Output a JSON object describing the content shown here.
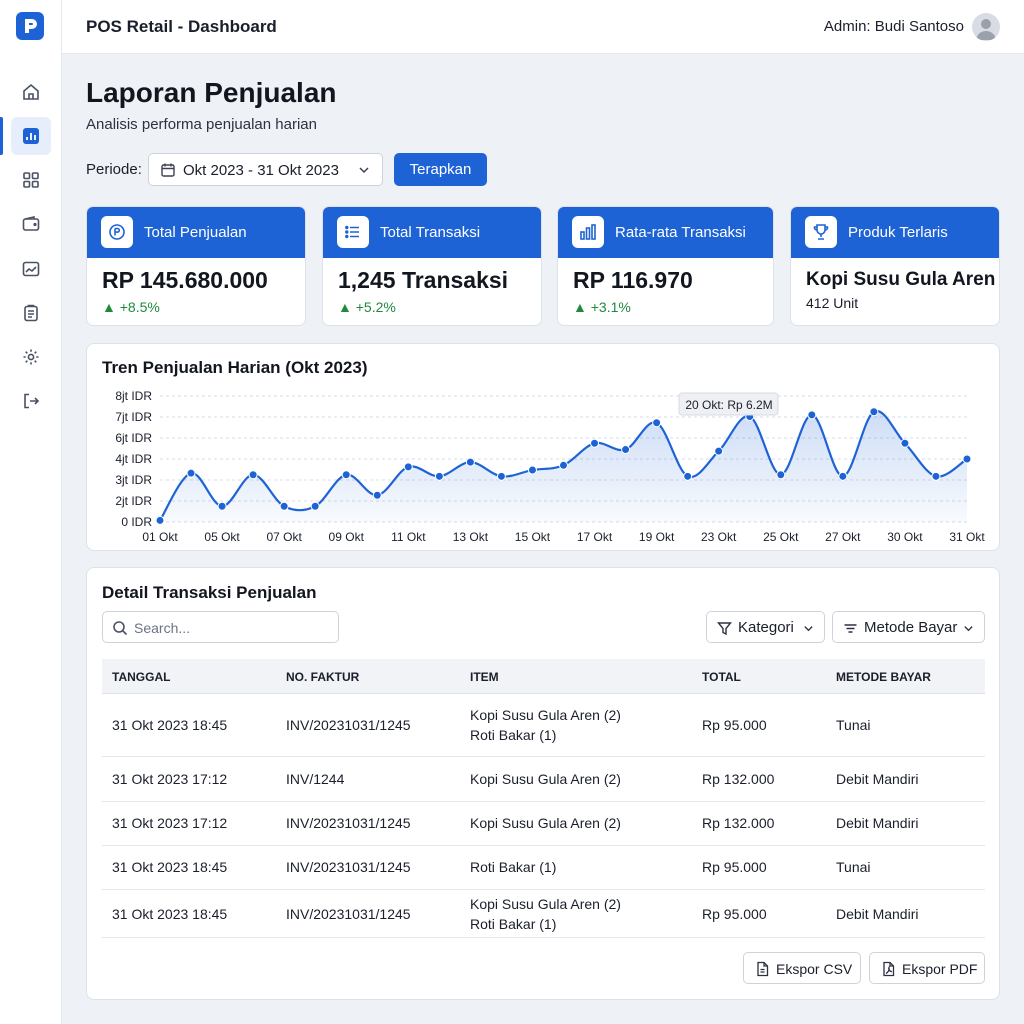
{
  "app": {
    "title": "POS Retail - Dashboard",
    "admin": "Admin: Budi Santoso"
  },
  "sidebar": {
    "items": [
      {
        "icon": "home-icon"
      },
      {
        "icon": "bar-chart-icon",
        "active": true
      },
      {
        "icon": "grid-icon"
      },
      {
        "icon": "wallet-icon"
      },
      {
        "icon": "image-chart-icon"
      },
      {
        "icon": "clipboard-icon"
      },
      {
        "icon": "gear-icon"
      },
      {
        "icon": "logout-icon"
      }
    ]
  },
  "header": {
    "title": "Laporan Penjualan",
    "subtitle": "Analisis performa penjualan harian",
    "periode_label": "Periode:",
    "periode_value": "Okt 2023 - 31 Okt 2023",
    "apply_label": "Terapkan"
  },
  "kpis": [
    {
      "title": "Total Penjualan",
      "value": "RP 145.680.000",
      "delta": "▲ +8.5%",
      "icon": "money-icon"
    },
    {
      "title": "Total Transaksi",
      "value": "1,245 Transaksi",
      "delta": "▲ +5.2%",
      "icon": "list-icon"
    },
    {
      "title": "Rata-rata Transaksi",
      "value": "RP 116.970",
      "delta": "▲ +3.1%",
      "icon": "bar-chart-icon"
    },
    {
      "title": "Produk Terlaris",
      "value": "Kopi Susu Gula Aren",
      "sub": "412 Unit",
      "icon": "trophy-icon"
    }
  ],
  "chart_data": {
    "type": "area",
    "title": "Tren Penjualan Harian (Okt 2023)",
    "y_tick_labels": [
      "0 IDR",
      "2jt IDR",
      "3jt IDR",
      "4jt IDR",
      "6jt IDR",
      "7jt IDR",
      "8jt IDR"
    ],
    "ylim": [
      0,
      8
    ],
    "x_tick_labels": [
      "01 Okt",
      "05 Okt",
      "07 Okt",
      "09 Okt",
      "11 Okt",
      "13 Okt",
      "15 Okt",
      "17 Okt",
      "19 Okt",
      "23 Okt",
      "25 Okt",
      "27 Okt",
      "30 Okt",
      "31 Okt"
    ],
    "series": [
      {
        "values": [
          0.1,
          3.1,
          1.0,
          3.0,
          1.0,
          1.0,
          3.0,
          1.7,
          3.5,
          2.9,
          3.8,
          2.9,
          3.3,
          3.6,
          5.0,
          4.6,
          6.3,
          2.9,
          4.5,
          6.7,
          3.0,
          6.8,
          2.9,
          7.0,
          5.0,
          2.9,
          4.0
        ],
        "color": "#1e63d6"
      }
    ],
    "annotation": "20 Okt: Rp 6.2M",
    "grid": true
  },
  "table": {
    "title": "Detail Transaksi Penjualan",
    "search_placeholder": "Search...",
    "filter_kategori": "Kategori",
    "filter_metode": "Metode Bayar",
    "columns": [
      "TANGGAL",
      "NO. FAKTUR",
      "ITEM",
      "TOTAL",
      "METODE BAYAR"
    ],
    "rows": [
      {
        "tanggal": "31 Okt 2023 18:45",
        "faktur": "INV/20231031/1245",
        "item1": "Kopi Susu Gula Aren (2)",
        "item2": "Roti Bakar (1)",
        "total": "Rp 95.000",
        "metode": "Tunai"
      },
      {
        "tanggal": "31 Okt 2023 17:12",
        "faktur": "INV/1244",
        "item1": "Kopi Susu Gula Aren (2)",
        "item2": "",
        "total": "Rp 132.000",
        "metode": "Debit Mandiri"
      },
      {
        "tanggal": "31 Okt 2023 17:12",
        "faktur": "INV/20231031/1245",
        "item1": "Kopi Susu Gula Aren (2)",
        "item2": "",
        "total": "Rp 132.000",
        "metode": "Debit Mandiri"
      },
      {
        "tanggal": "31 Okt 2023 18:45",
        "faktur": "INV/20231031/1245",
        "item1": "Roti Bakar (1)",
        "item2": "",
        "total": "Rp 95.000",
        "metode": "Tunai"
      },
      {
        "tanggal": "31 Okt 2023 18:45",
        "faktur": "INV/20231031/1245",
        "item1": "Kopi Susu Gula Aren (2)",
        "item2": "Roti Bakar (1)",
        "total": "Rp 95.000",
        "metode": "Debit Mandiri"
      }
    ],
    "export_csv": "Ekspor CSV",
    "export_pdf": "Ekspor PDF"
  }
}
